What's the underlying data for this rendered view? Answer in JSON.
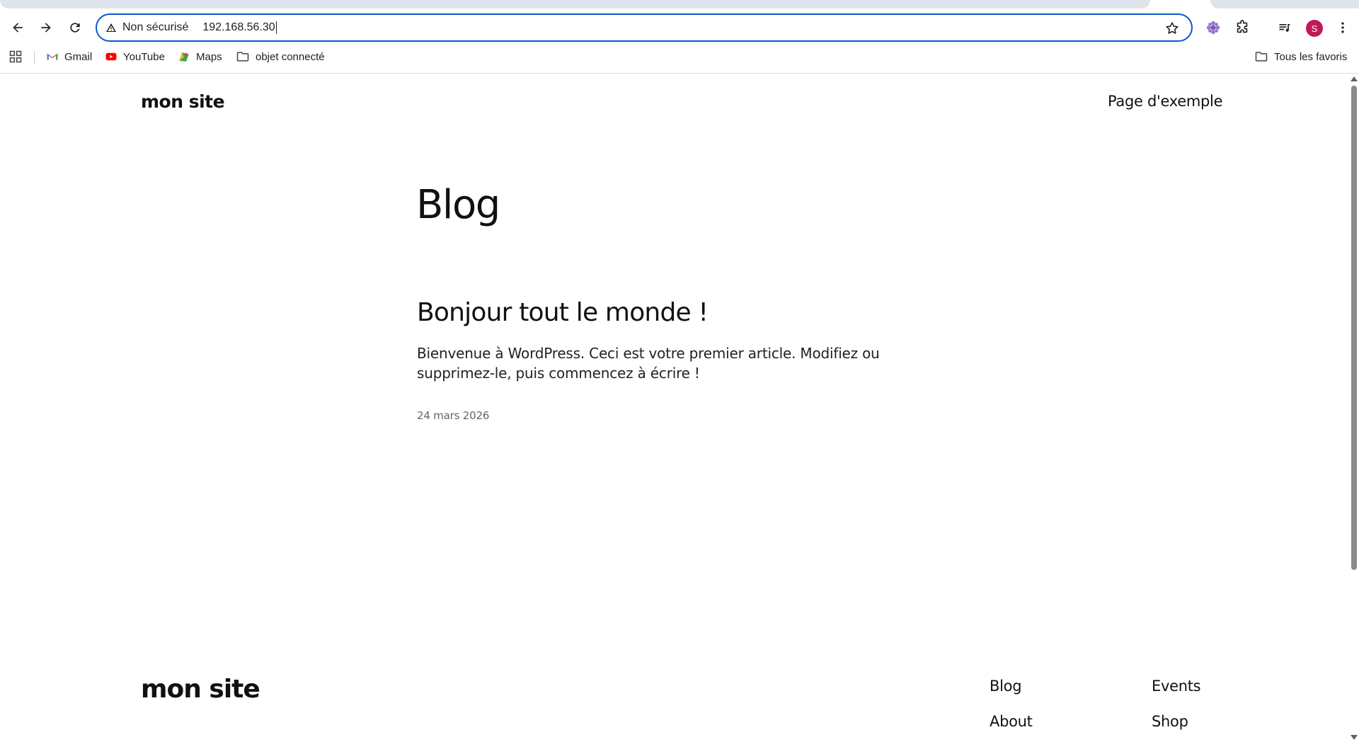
{
  "browser": {
    "omnibox": {
      "security_status": "Non sécurisé",
      "url": "192.168.56.30"
    },
    "profile_initial": "S",
    "bookmarks": [
      {
        "label": "Gmail",
        "icon": "gmail-icon"
      },
      {
        "label": "YouTube",
        "icon": "youtube-icon"
      },
      {
        "label": "Maps",
        "icon": "maps-icon"
      },
      {
        "label": "objet connecté",
        "icon": "folder-icon"
      }
    ],
    "all_bookmarks": "Tous les favoris",
    "colors": {
      "focus_ring": "#0b57d0",
      "avatar": "#c2185b",
      "youtube": "#ff0000"
    }
  },
  "site": {
    "header": {
      "title": "mon site",
      "nav_link": "Page d'exemple"
    },
    "main": {
      "heading": "Blog",
      "post": {
        "title": "Bonjour tout le monde !",
        "excerpt": "Bienvenue à WordPress. Ceci est votre premier article. Modifiez ou supprimez-le, puis commencez à écrire !",
        "date": "24 mars 2026"
      }
    },
    "footer": {
      "title": "mon site",
      "links": [
        "Blog",
        "Events",
        "About",
        "Shop"
      ]
    }
  }
}
